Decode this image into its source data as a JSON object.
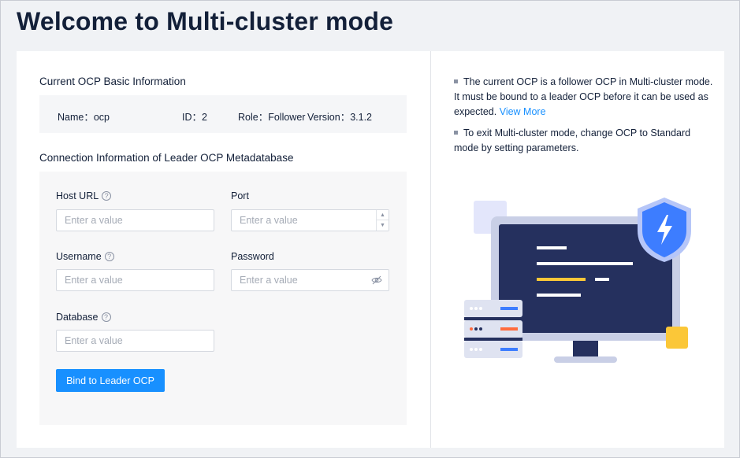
{
  "page": {
    "title": "Welcome to Multi-cluster mode"
  },
  "basic_info": {
    "title": "Current OCP Basic Information",
    "name": "Name：ocp",
    "id": "ID：2",
    "role": "Role：Follower",
    "version": "Version：3.1.2"
  },
  "connection": {
    "title": "Connection Information of Leader OCP Metadatabase",
    "host_url": {
      "label": "Host URL",
      "placeholder": "Enter a value",
      "value": ""
    },
    "port": {
      "label": "Port",
      "placeholder": "Enter a value",
      "value": ""
    },
    "username": {
      "label": "Username",
      "placeholder": "Enter a value",
      "value": ""
    },
    "password": {
      "label": "Password",
      "placeholder": "Enter a value",
      "value": ""
    },
    "database": {
      "label": "Database",
      "placeholder": "Enter a value",
      "value": ""
    },
    "bind_button_label": "Bind to Leader OCP"
  },
  "notes": {
    "note1": "The current OCP is a follower OCP in Multi-cluster mode. It must be bound to a leader OCP before it can be used as expected.",
    "view_more": "View More",
    "note2": "To exit Multi-cluster mode, change OCP to Standard mode by setting parameters."
  },
  "icons": {
    "help": "question-circle-icon",
    "eye": "eye-invisible-icon",
    "shield": "shield-lightning-icon",
    "monitor": "monitor-illustration",
    "server": "server-stack-illustration"
  },
  "colors": {
    "primary": "#1890ff",
    "monitor_screen": "#25305e",
    "accent_yellow": "#fbc738",
    "shield_blue": "#3d7dff"
  }
}
